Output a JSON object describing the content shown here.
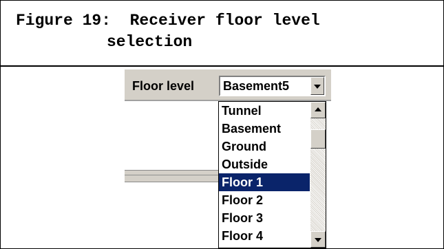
{
  "figure": {
    "caption_line1": "Figure 19:  Receiver floor level",
    "caption_line2": "selection"
  },
  "floor_selector": {
    "label": "Floor level",
    "selected_value": "Basement5",
    "options": [
      "Tunnel",
      "Basement",
      "Ground",
      "Outside",
      "Floor 1",
      "Floor 2",
      "Floor 3",
      "Floor 4"
    ],
    "highlighted_option": "Floor 1"
  },
  "colors": {
    "highlight": "#0a246a",
    "dialog_gray": "#d4d0c8"
  }
}
